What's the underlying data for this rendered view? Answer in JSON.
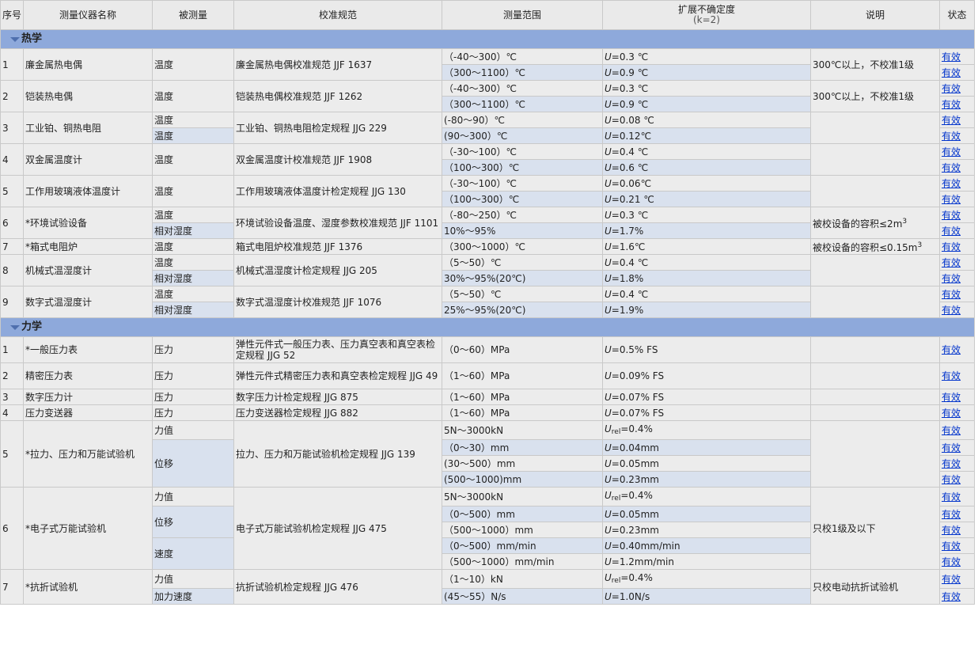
{
  "headers": [
    "序号",
    "测量仪器名称",
    "被测量",
    "校准规范",
    "测量范围",
    "扩展不确定度",
    "(k=2)",
    "说明",
    "状态"
  ],
  "status_label": "有效",
  "sections": [
    {
      "name": "热学",
      "items": [
        {
          "no": "1",
          "name": "廉金属热电偶",
          "note": "300℃以上，不校准1级",
          "rows": [
            {
              "measurand": "温度",
              "span": 2,
              "std": "廉金属热电偶校准规范 JJF 1637",
              "stdspan": 2,
              "range": "（-40～300）℃",
              "unc": "=0.3 ℃"
            },
            {
              "range": "（300～1100）℃",
              "unc": "=0.9 ℃"
            }
          ]
        },
        {
          "no": "2",
          "name": "铠装热电偶",
          "note": "300℃以上，不校准1级",
          "rows": [
            {
              "measurand": "温度",
              "span": 2,
              "std": "铠装热电偶校准规范 JJF 1262",
              "stdspan": 2,
              "range": "（-40～300）℃",
              "unc": "=0.3 ℃"
            },
            {
              "range": "（300～1100）℃",
              "unc": "=0.9 ℃"
            }
          ]
        },
        {
          "no": "3",
          "name": "工业铂、铜热电阻",
          "note": "",
          "rows": [
            {
              "measurand": "温度",
              "span": 1,
              "std": "工业铂、铜热电阻检定规程 JJG 229",
              "stdspan": 2,
              "range": "(-80～90）℃",
              "unc": "=0.08 ℃"
            },
            {
              "measurand": "温度",
              "span": 1,
              "range": "(90～300）℃",
              "unc": "=0.12℃"
            }
          ]
        },
        {
          "no": "4",
          "name": "双金属温度计",
          "note": "",
          "rows": [
            {
              "measurand": "温度",
              "span": 2,
              "std": "双金属温度计校准规范 JJF 1908",
              "stdspan": 2,
              "range": "（-30～100）℃",
              "unc": "=0.4 ℃"
            },
            {
              "range": "（100～300）℃",
              "unc": "=0.6 ℃"
            }
          ]
        },
        {
          "no": "5",
          "name": "工作用玻璃液体温度计",
          "note": "",
          "rows": [
            {
              "measurand": "温度",
              "span": 2,
              "std": "工作用玻璃液体温度计检定规程 JJG 130",
              "stdspan": 2,
              "range": "（-30～100）℃",
              "unc": "=0.06℃"
            },
            {
              "range": "（100～300）℃",
              "unc": "=0.21 ℃"
            }
          ]
        },
        {
          "no": "6",
          "name": "*环境试验设备",
          "note": "被校设备的容积≤2m",
          "note_sup": "3",
          "rows": [
            {
              "measurand": "温度",
              "span": 1,
              "std": "环境试验设备温度、湿度参数校准规范 JJF 1101",
              "stdspan": 2,
              "range": "（-80～250）℃",
              "unc": "=0.3 ℃"
            },
            {
              "measurand": "相对湿度",
              "span": 1,
              "range": "10%～95%",
              "unc": "=1.7%"
            }
          ]
        },
        {
          "no": "7",
          "name": "*箱式电阻炉",
          "note": "被校设备的容积≤0.15m",
          "note_sup": "3",
          "rows": [
            {
              "measurand": "温度",
              "span": 1,
              "std": "箱式电阻炉校准规范 JJF 1376",
              "stdspan": 1,
              "range": "（300～1000）℃",
              "unc": "=1.6℃"
            }
          ]
        },
        {
          "no": "8",
          "name": "机械式温湿度计",
          "note": "",
          "rows": [
            {
              "measurand": "温度",
              "span": 1,
              "std": "机械式温湿度计检定规程 JJG 205",
              "stdspan": 2,
              "range": "（5～50）℃",
              "unc": "=0.4 ℃"
            },
            {
              "measurand": "相对湿度",
              "span": 1,
              "range": "30%～95%(20℃)",
              "unc": "=1.8%"
            }
          ]
        },
        {
          "no": "9",
          "name": "数字式温湿度计",
          "note": "",
          "rows": [
            {
              "measurand": "温度",
              "span": 1,
              "std": "数字式温湿度计校准规范 JJF 1076",
              "stdspan": 2,
              "range": "（5～50）℃",
              "unc": "=0.4 ℃"
            },
            {
              "measurand": "相对湿度",
              "span": 1,
              "range": "25%～95%(20℃)",
              "unc": "=1.9%"
            }
          ]
        }
      ]
    },
    {
      "name": "力学",
      "items": [
        {
          "no": "1",
          "name": "*一般压力表",
          "note": "",
          "tall": true,
          "rows": [
            {
              "measurand": "压力",
              "span": 1,
              "std": "弹性元件式一般压力表、压力真空表和真空表检定规程 JJG 52",
              "stdspan": 1,
              "range": "（0～60）MPa",
              "unc": "=0.5% FS"
            }
          ]
        },
        {
          "no": "2",
          "name": "精密压力表",
          "note": "",
          "tall": true,
          "rows": [
            {
              "measurand": "压力",
              "span": 1,
              "std": "弹性元件式精密压力表和真空表检定规程 JJG 49",
              "stdspan": 1,
              "range": "（1～60）MPa",
              "unc": "=0.09% FS"
            }
          ]
        },
        {
          "no": "3",
          "name": "数字压力计",
          "note": "",
          "rows": [
            {
              "measurand": "压力",
              "span": 1,
              "std": "数字压力计检定规程 JJG 875",
              "stdspan": 1,
              "range": "（1～60）MPa",
              "unc": "=0.07% FS"
            }
          ]
        },
        {
          "no": "4",
          "name": "压力变送器",
          "note": "",
          "rows": [
            {
              "measurand": "压力",
              "span": 1,
              "std": "压力变送器检定规程 JJG 882",
              "stdspan": 1,
              "range": "（1～60）MPa",
              "unc": "=0.07% FS"
            }
          ]
        },
        {
          "no": "5",
          "name": "*拉力、压力和万能试验机",
          "note": "",
          "rows": [
            {
              "measurand": "力值",
              "span": 1,
              "std": "拉力、压力和万能试验机检定规程 JJG 139",
              "stdspan": 4,
              "range": "5N～3000kN",
              "unc": "=0.4%",
              "rel": true,
              "tall": true
            },
            {
              "measurand": "位移",
              "span": 3,
              "range": "（0～30）mm",
              "unc": "=0.04mm"
            },
            {
              "range": "(30～500）mm",
              "unc": "=0.05mm"
            },
            {
              "range": "(500～1000)mm",
              "unc": "=0.23mm"
            }
          ]
        },
        {
          "no": "6",
          "name": "*电子式万能试验机",
          "note": "只校1级及以下",
          "rows": [
            {
              "measurand": "力值",
              "span": 1,
              "std": "电子式万能试验机检定规程 JJG 475",
              "stdspan": 5,
              "range": "5N～3000kN",
              "unc": "=0.4%",
              "rel": true,
              "tall": true
            },
            {
              "measurand": "位移",
              "span": 2,
              "range": "（0～500）mm",
              "unc": "=0.05mm"
            },
            {
              "range": "（500～1000）mm",
              "unc": "=0.23mm"
            },
            {
              "measurand": "速度",
              "span": 2,
              "range": "（0～500）mm/min",
              "unc": "=0.40mm/min"
            },
            {
              "range": "（500～1000）mm/min",
              "unc": "=1.2mm/min"
            }
          ]
        },
        {
          "no": "7",
          "name": "*抗折试验机",
          "note": "只校电动抗折试验机",
          "rows": [
            {
              "measurand": "力值",
              "span": 1,
              "std": "抗折试验机检定规程 JJG 476",
              "stdspan": 2,
              "range": "（1～10）kN",
              "unc": "=0.4%",
              "rel": true,
              "tall": true
            },
            {
              "measurand": "加力速度",
              "span": 1,
              "range": "(45～55）N/s",
              "unc": "=1.0N/s"
            }
          ]
        }
      ]
    }
  ]
}
